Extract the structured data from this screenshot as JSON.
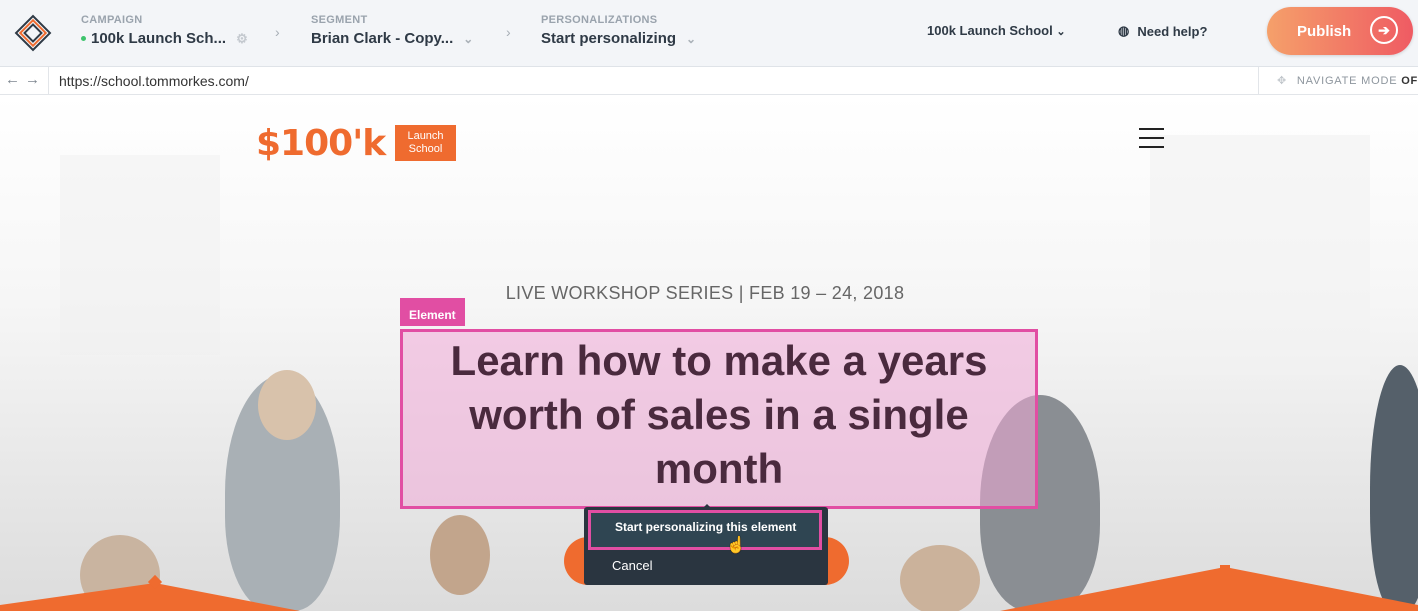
{
  "topbar": {
    "campaign": {
      "label": "CAMPAIGN",
      "value": "100k Launch Sch..."
    },
    "segment": {
      "label": "SEGMENT",
      "value": "Brian Clark - Copy..."
    },
    "personalizations": {
      "label": "PERSONALIZATIONS",
      "value": "Start personalizing"
    },
    "account": "100k Launch School",
    "help": "Need help?",
    "publish": "Publish"
  },
  "addressbar": {
    "url": "https://school.tommorkes.com/",
    "navigate_mode_label": "NAVIGATE MODE",
    "navigate_mode_state": "OFF"
  },
  "page": {
    "logo_text": "$100'k",
    "logo_tag_line1": "Launch",
    "logo_tag_line2": "School",
    "subhead": "LIVE WORKSHOP SERIES | FEB 19 – 24, 2018",
    "element_tag": "Element",
    "headline": "Learn how to make a years worth of sales in a single month"
  },
  "popup": {
    "start": "Start personalizing this element",
    "cancel": "Cancel"
  },
  "colors": {
    "accent_pink": "#e14ea3",
    "brand_orange": "#ef6b2f",
    "publish_gradient": [
      "#f5a06a",
      "#ef5b63"
    ]
  },
  "icons": [
    "app-logo-icon",
    "gear-icon",
    "chevron-down-icon",
    "chevron-right-icon",
    "back-arrow-icon",
    "forward-arrow-icon",
    "globe-help-icon",
    "arrow-right-circle-icon",
    "navigate-mode-icon",
    "hamburger-menu-icon",
    "pointer-cursor-icon"
  ]
}
